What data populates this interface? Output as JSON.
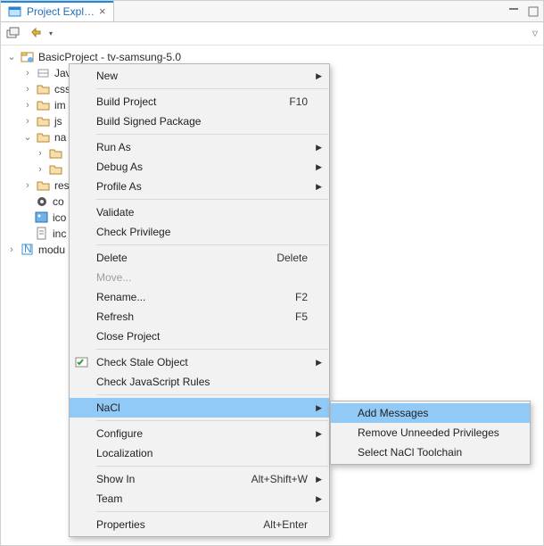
{
  "header": {
    "tab_title": "Project Expl…"
  },
  "tree": {
    "root": "BasicProject - tv-samsung-5.0",
    "items": [
      {
        "label": "Jav"
      },
      {
        "label": "css"
      },
      {
        "label": "im"
      },
      {
        "label": "js"
      },
      {
        "label": "na",
        "expanded": true
      },
      {
        "label": "res"
      },
      {
        "label": "co"
      },
      {
        "label": "ico"
      },
      {
        "label": "inc"
      }
    ],
    "modu": "modu"
  },
  "menu": [
    {
      "label": "New",
      "submenu": true
    },
    {
      "sep": true
    },
    {
      "label": "Build Project",
      "accel": "F10"
    },
    {
      "label": "Build Signed Package"
    },
    {
      "sep": true
    },
    {
      "label": "Run As",
      "submenu": true
    },
    {
      "label": "Debug As",
      "submenu": true
    },
    {
      "label": "Profile As",
      "submenu": true
    },
    {
      "sep": true
    },
    {
      "label": "Validate"
    },
    {
      "label": "Check Privilege"
    },
    {
      "sep": true
    },
    {
      "label": "Delete",
      "accel": "Delete"
    },
    {
      "label": "Move...",
      "disabled": true
    },
    {
      "label": "Rename...",
      "accel": "F2"
    },
    {
      "label": "Refresh",
      "accel": "F5"
    },
    {
      "label": "Close Project"
    },
    {
      "sep": true
    },
    {
      "label": "Check Stale Object",
      "submenu": true,
      "icon": "check-stale"
    },
    {
      "label": "Check JavaScript Rules"
    },
    {
      "sep": true
    },
    {
      "label": "NaCl",
      "submenu": true,
      "selected": true
    },
    {
      "sep": true
    },
    {
      "label": "Configure",
      "submenu": true
    },
    {
      "label": "Localization"
    },
    {
      "sep": true
    },
    {
      "label": "Show In",
      "accel": "Alt+Shift+W",
      "submenu": true
    },
    {
      "label": "Team",
      "submenu": true
    },
    {
      "sep": true
    },
    {
      "label": "Properties",
      "accel": "Alt+Enter"
    }
  ],
  "submenu": [
    {
      "label": "Add Messages",
      "selected": true
    },
    {
      "label": "Remove Unneeded Privileges"
    },
    {
      "label": "Select NaCl Toolchain"
    }
  ]
}
